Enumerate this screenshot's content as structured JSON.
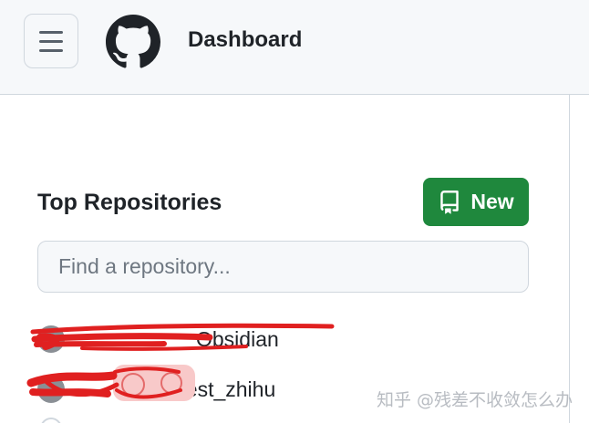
{
  "header": {
    "title": "Dashboard",
    "menu_icon": "hamburger-icon",
    "logo_icon": "github-octocat-logo"
  },
  "repositories": {
    "title": "Top Repositories",
    "new_button_label": "New",
    "new_button_icon": "repo-book-icon",
    "search_placeholder": "Find a repository...",
    "items": [
      {
        "name": "Obsidian"
      },
      {
        "name": "/test_zhihu"
      }
    ]
  },
  "watermark": "知乎 @残差不收敛怎么办",
  "colors": {
    "accent_green": "#1f883d",
    "header_bg": "#f6f8fa",
    "border": "#d0d7de",
    "redaction_red": "#e02020"
  }
}
